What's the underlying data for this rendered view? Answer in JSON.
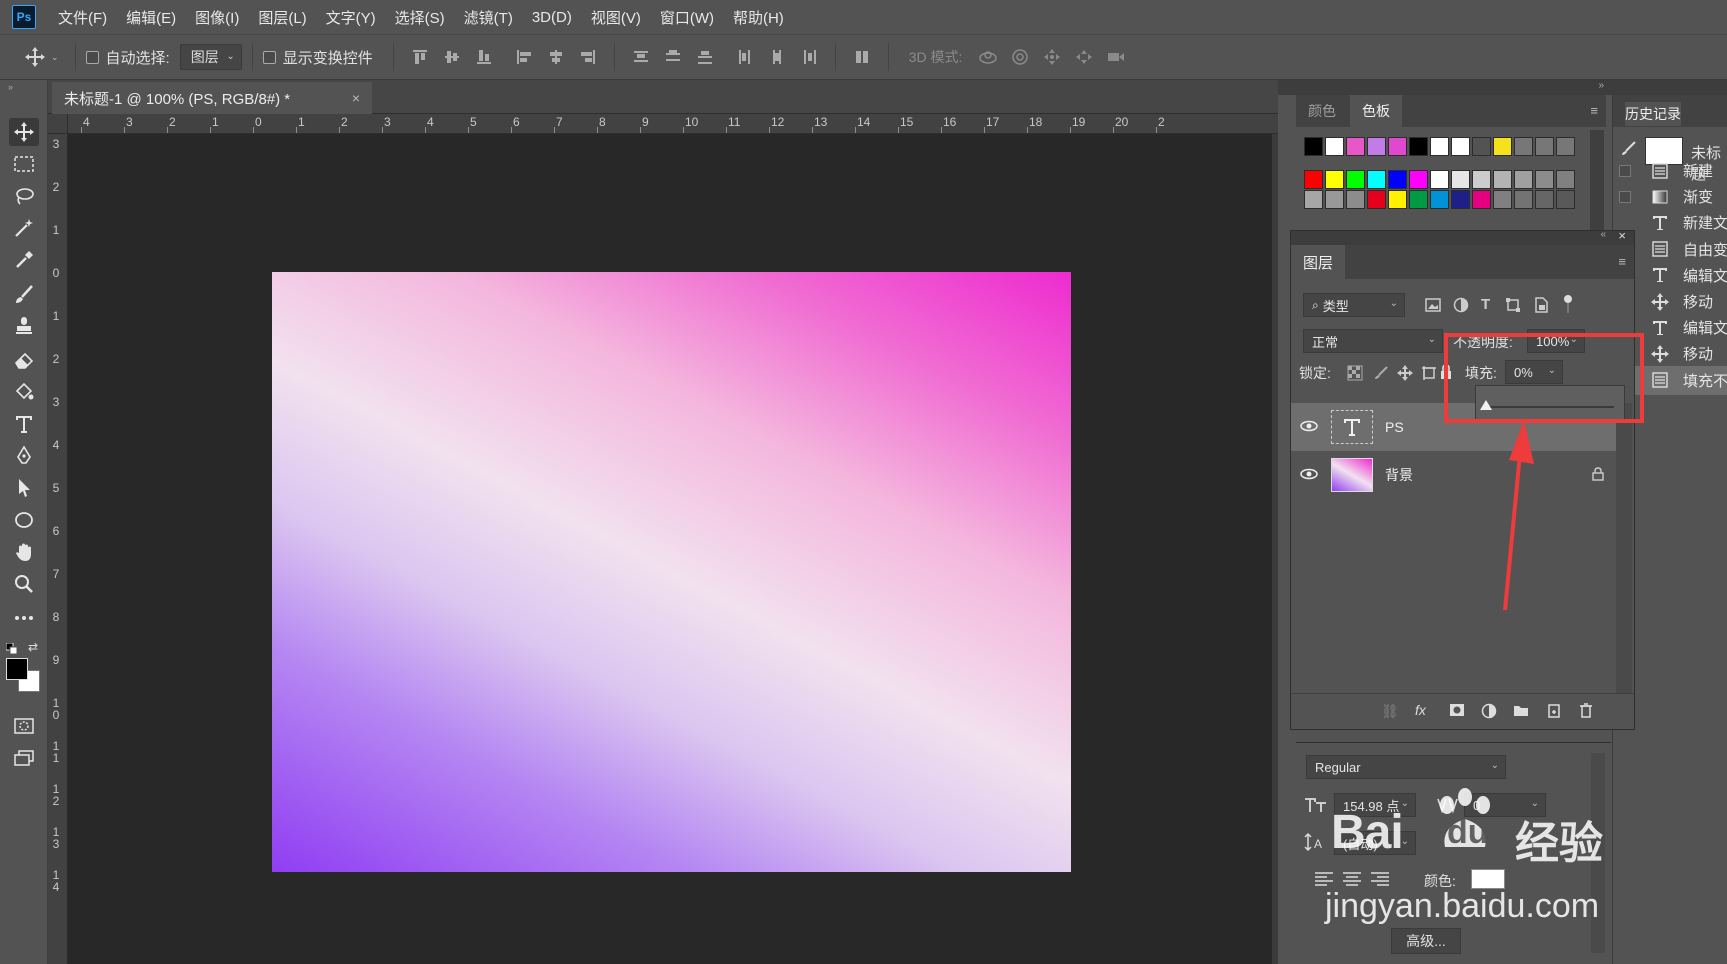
{
  "app": {
    "logo": "Ps"
  },
  "menu": [
    "文件(F)",
    "编辑(E)",
    "图像(I)",
    "图层(L)",
    "文字(Y)",
    "选择(S)",
    "滤镜(T)",
    "3D(D)",
    "视图(V)",
    "窗口(W)",
    "帮助(H)"
  ],
  "options": {
    "auto_select_label": "自动选择:",
    "auto_select_value": "图层",
    "show_transform_label": "显示变换控件",
    "mode_3d_label": "3D 模式:"
  },
  "document": {
    "tab_title": "未标题-1 @ 100% (PS, RGB/8#) *",
    "close": "×"
  },
  "rulers": {
    "top": [
      "4",
      "3",
      "2",
      "1",
      "0",
      "1",
      "2",
      "3",
      "4",
      "5",
      "6",
      "7",
      "8",
      "9",
      "10",
      "11",
      "12",
      "13",
      "14",
      "15",
      "16",
      "17",
      "18",
      "19",
      "20",
      "2"
    ],
    "left": [
      "3",
      "2",
      "1",
      "0",
      "1",
      "2",
      "3",
      "4",
      "5",
      "6",
      "7",
      "8",
      "9",
      "1\n0",
      "1\n1",
      "1\n2",
      "1\n3",
      "1\n4"
    ]
  },
  "swatches": {
    "tab_color": "颜色",
    "tab_swatches": "色板",
    "row1": [
      "#000000",
      "#ffffff",
      "#e658c8",
      "#c37be8",
      "#e048d0",
      "#000000",
      "#ffffff",
      "#ffffff",
      "#535353",
      "#f5e21d",
      "#777777",
      "#777777",
      "#777777"
    ],
    "row2": [
      "#ff0000",
      "#ffff00",
      "#00ff00",
      "#00ffff",
      "#0000ff",
      "#ff00ff",
      "#ffffff",
      "#e6e6e6",
      "#cccccc",
      "#b3b3b3",
      "#a0a0a0",
      "#8c8c8c",
      "#808080"
    ],
    "row3": [
      "#a6a6a6",
      "#999999",
      "#8c8c8c",
      "#e5001c",
      "#fff100",
      "#009a44",
      "#0092d6",
      "#1d2088",
      "#e4007f",
      "#808080",
      "#737373",
      "#666666",
      "#595959"
    ]
  },
  "history": {
    "tab": "历史记录",
    "snapshot_label": "未标题",
    "items": [
      {
        "icon": "doc-icon",
        "label": "新建"
      },
      {
        "icon": "gradient-icon",
        "label": "渐变"
      },
      {
        "icon": "type-icon",
        "label": "新建文"
      },
      {
        "icon": "doc-icon",
        "label": "自由变"
      },
      {
        "icon": "type-icon",
        "label": "编辑文"
      },
      {
        "icon": "move-icon",
        "label": "移动"
      },
      {
        "icon": "type-icon",
        "label": "编辑文"
      },
      {
        "icon": "move-icon",
        "label": "移动"
      },
      {
        "icon": "doc-icon",
        "label": "填充不"
      }
    ]
  },
  "layers": {
    "tab": "图层",
    "filter_kind": "类型",
    "blend_mode": "正常",
    "opacity_label": "不透明度:",
    "opacity_value": "100%",
    "lock_label": "锁定:",
    "fill_label": "填充:",
    "fill_value": "0%",
    "fill_level": 0,
    "items": [
      {
        "name": "PS",
        "type": "text",
        "selected": true
      },
      {
        "name": "背景",
        "type": "background",
        "locked": true
      }
    ]
  },
  "character": {
    "font_style": "Regular",
    "font_size": "154.98 点",
    "tracking": "0",
    "leading": "(自动)",
    "color_label": "颜色:",
    "advanced_button": "高级..."
  },
  "watermark": {
    "brand": "Bai",
    "brand2": "du",
    "product": "经验",
    "url": "jingyan.baidu.com"
  },
  "colors": {
    "highlight": "#ee3b3b",
    "arrow": "#ee3b3b",
    "ps_blue": "#31a8ff"
  }
}
